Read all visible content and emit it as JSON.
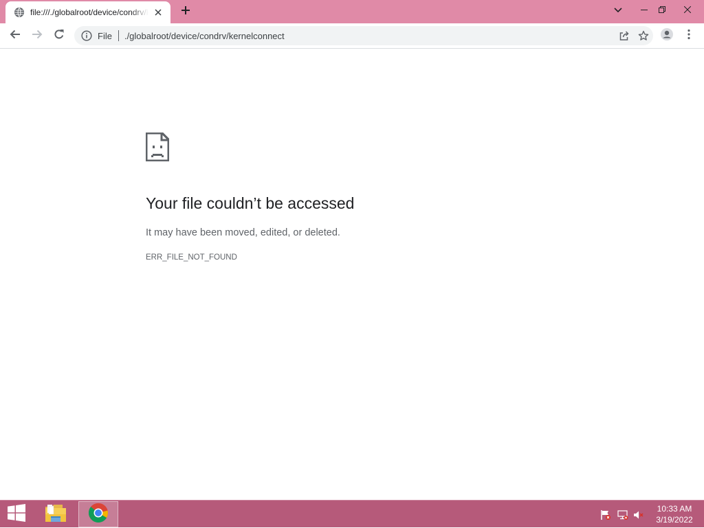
{
  "browser": {
    "tab": {
      "title": "file:///./globalroot/device/condrv/kernelconnect",
      "favicon": "globe-icon",
      "close_icon": "close-icon"
    },
    "new_tab_icon": "plus-icon",
    "window_controls": [
      "tab-search-icon",
      "minimize-icon",
      "restore-icon",
      "close-icon"
    ],
    "toolbar": {
      "back_icon": "back-arrow-icon",
      "forward_icon": "forward-arrow-icon",
      "reload_icon": "reload-icon",
      "site_info_icon": "info-icon",
      "scheme_chip": "File",
      "url": "./globalroot/device/condrv/kernelconnect",
      "share_icon": "share-icon",
      "bookmark_icon": "star-icon",
      "profile_icon": "profile-icon",
      "menu_icon": "kebab-menu-icon"
    },
    "colors": {
      "frame": "#e08aa7",
      "toolbar": "#ffffff",
      "omnibox": "#f1f3f4"
    }
  },
  "error_page": {
    "icon": "sad-file-icon",
    "heading": "Your file couldn’t be accessed",
    "message": "It may have been moved, edited, or deleted.",
    "code": "ERR_FILE_NOT_FOUND"
  },
  "taskbar": {
    "start_icon": "windows-logo-icon",
    "apps": [
      {
        "name": "file-explorer-icon",
        "active": false
      },
      {
        "name": "chrome-icon",
        "active": true
      }
    ],
    "tray": [
      "action-center-flag-icon",
      "network-icon",
      "volume-muted-icon"
    ],
    "clock": {
      "time": "10:33 AM",
      "date": "3/19/2022"
    },
    "color": "#b65a7a"
  }
}
